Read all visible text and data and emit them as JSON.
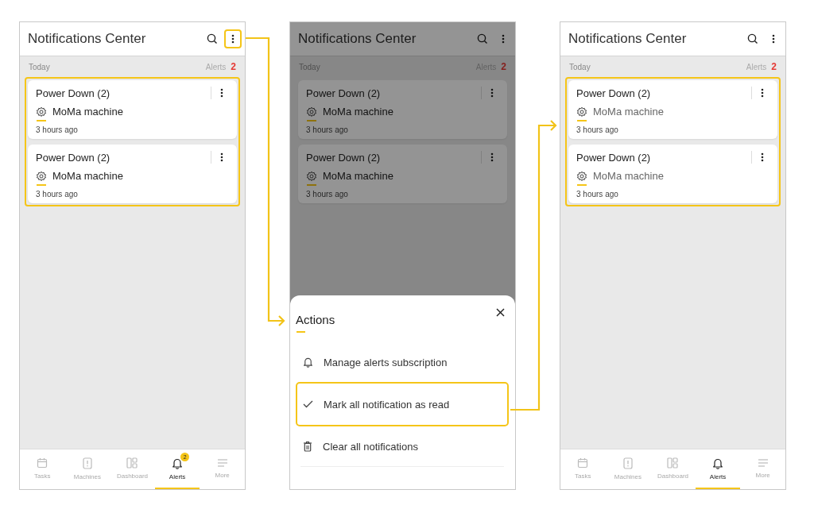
{
  "screens": [
    {
      "dimmed": false,
      "menu_highlighted": true,
      "cards_highlighted": true,
      "title": "Notifications Center",
      "section": "Today",
      "alerts_label": "Alerts",
      "alerts_count": "2",
      "cards": [
        {
          "title": "Power Down (2)",
          "machine": "MoMa machine",
          "time": "3 hours ago",
          "read": false
        },
        {
          "title": "Power Down (2)",
          "machine": "MoMa machine",
          "time": "3 hours ago",
          "read": false
        }
      ],
      "nav": [
        {
          "kind": "calendar",
          "label": "Tasks",
          "selected": false
        },
        {
          "kind": "tablet",
          "label": "Machines",
          "selected": false
        },
        {
          "kind": "dashboard",
          "label": "Dashboard",
          "selected": false
        },
        {
          "kind": "bell",
          "label": "Alerts",
          "selected": true,
          "badge": "2"
        },
        {
          "kind": "lines",
          "label": "More",
          "selected": false
        }
      ]
    },
    {
      "dimmed": true,
      "menu_highlighted": false,
      "cards_highlighted": false,
      "title": "Notifications Center",
      "section": "Today",
      "alerts_label": "Alerts",
      "alerts_count": "2",
      "cards": [
        {
          "title": "Power Down (2)",
          "machine": "MoMa machine",
          "time": "3 hours ago",
          "read": false
        },
        {
          "title": "Power Down (2)",
          "machine": "MoMa machine",
          "time": "3 hours ago",
          "read": false
        }
      ],
      "sheet": {
        "title": "Actions",
        "items": [
          {
            "kind": "bell",
            "label": "Manage alerts subscription",
            "highlighted": false
          },
          {
            "kind": "check",
            "label": "Mark all notification as read",
            "highlighted": true
          },
          {
            "kind": "trash",
            "label": "Clear all notifications",
            "highlighted": false
          }
        ]
      }
    },
    {
      "dimmed": false,
      "menu_highlighted": false,
      "cards_highlighted": true,
      "title": "Notifications Center",
      "section": "Today",
      "alerts_label": "Alerts",
      "alerts_count": "2",
      "cards": [
        {
          "title": "Power Down (2)",
          "machine": "MoMa machine",
          "time": "3 hours ago",
          "read": true
        },
        {
          "title": "Power Down (2)",
          "machine": "MoMa machine",
          "time": "3 hours ago",
          "read": true
        }
      ],
      "nav": [
        {
          "kind": "calendar",
          "label": "Tasks",
          "selected": false
        },
        {
          "kind": "tablet",
          "label": "Machines",
          "selected": false
        },
        {
          "kind": "dashboard",
          "label": "Dashboard",
          "selected": false
        },
        {
          "kind": "bell",
          "label": "Alerts",
          "selected": true
        },
        {
          "kind": "lines",
          "label": "More",
          "selected": false
        }
      ]
    }
  ]
}
